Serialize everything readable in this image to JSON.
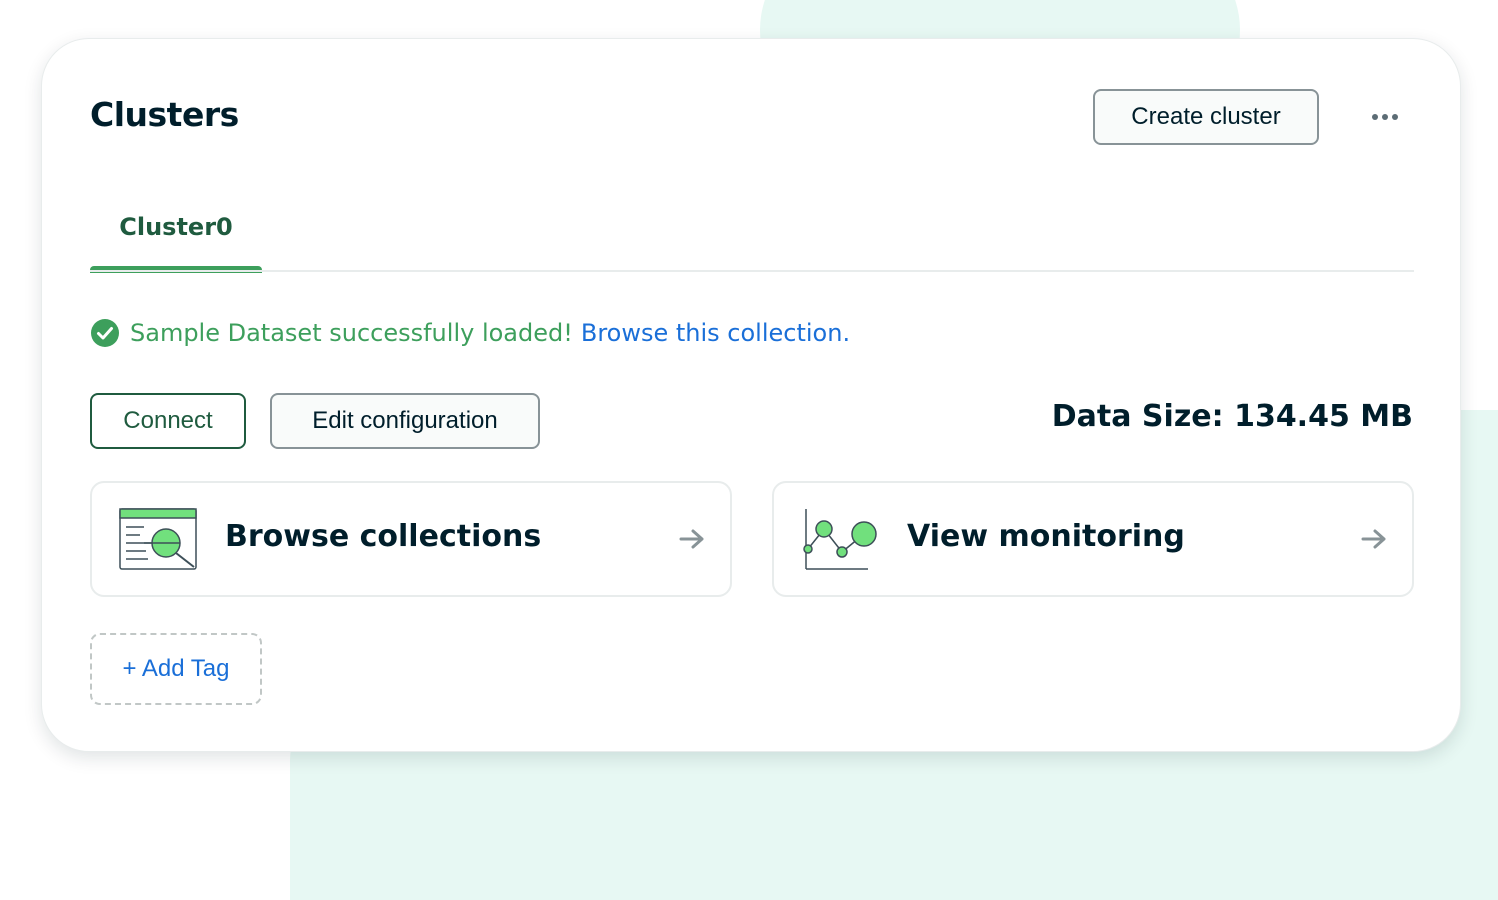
{
  "header": {
    "title": "Clusters",
    "create_label": "Create cluster",
    "more_icon": "ellipsis-horizontal-icon"
  },
  "tabs": [
    {
      "label": "Cluster0",
      "active": true
    }
  ],
  "status": {
    "icon": "check-circle-icon",
    "message": "Sample Dataset successfully loaded!",
    "link": "Browse this collection."
  },
  "actions": {
    "connect_label": "Connect",
    "edit_label": "Edit configuration",
    "data_size": "Data Size: 134.45 MB"
  },
  "cards": [
    {
      "label": "Browse collections",
      "icon": "browse-collections-illustration-icon",
      "arrow": "arrow-right-icon"
    },
    {
      "label": "View monitoring",
      "icon": "monitoring-chart-illustration-icon",
      "arrow": "arrow-right-icon"
    }
  ],
  "tag": {
    "label": "+ Add Tag"
  },
  "colors": {
    "primary_text": "#001e2b",
    "brand_green": "#3d9f5c",
    "dark_green": "#1f5b3f",
    "link_blue": "#1a6fd8",
    "background_mint": "#e7f8f3",
    "icon_fill_green": "#71e07d"
  }
}
